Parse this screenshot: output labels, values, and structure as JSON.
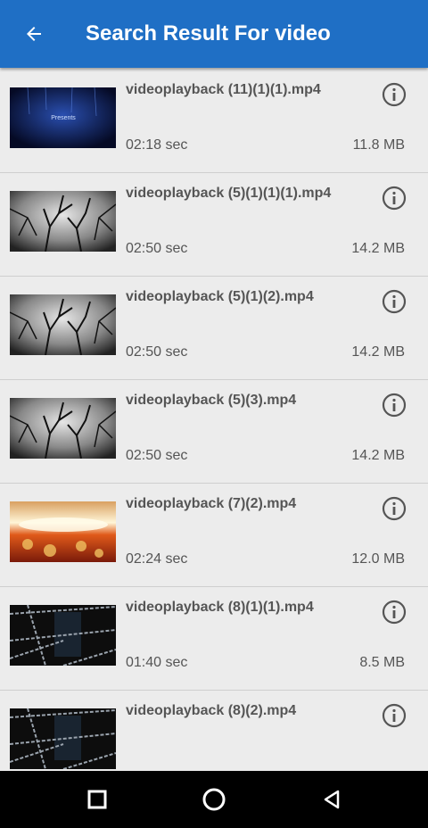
{
  "header": {
    "title": "Search Result For video"
  },
  "videos": [
    {
      "name": "videoplayback (11)(1)(1).mp4",
      "duration": "02:18 sec",
      "size": "11.8 MB",
      "thumb": "presents"
    },
    {
      "name": "videoplayback (5)(1)(1)(1).mp4",
      "duration": "02:50 sec",
      "size": "14.2 MB",
      "thumb": "trees"
    },
    {
      "name": "videoplayback (5)(1)(2).mp4",
      "duration": "02:50 sec",
      "size": "14.2 MB",
      "thumb": "trees"
    },
    {
      "name": "videoplayback (5)(3).mp4",
      "duration": "02:50 sec",
      "size": "14.2 MB",
      "thumb": "trees"
    },
    {
      "name": "videoplayback (7)(2).mp4",
      "duration": "02:24 sec",
      "size": "12.0 MB",
      "thumb": "fire"
    },
    {
      "name": "videoplayback (8)(1)(1).mp4",
      "duration": "01:40 sec",
      "size": "8.5 MB",
      "thumb": "chains"
    },
    {
      "name": "videoplayback (8)(2).mp4",
      "duration": "",
      "size": "",
      "thumb": "chains"
    }
  ],
  "thumb_overlay_text": "Presents",
  "colors": {
    "appbar": "#1f6fc5",
    "background": "#ececec",
    "text": "#555555",
    "navbar": "#000000"
  },
  "icons": {
    "back": "arrow-left-icon",
    "info": "info-circle-icon",
    "recents": "square-icon",
    "home": "circle-icon",
    "back_nav": "triangle-back-icon"
  }
}
